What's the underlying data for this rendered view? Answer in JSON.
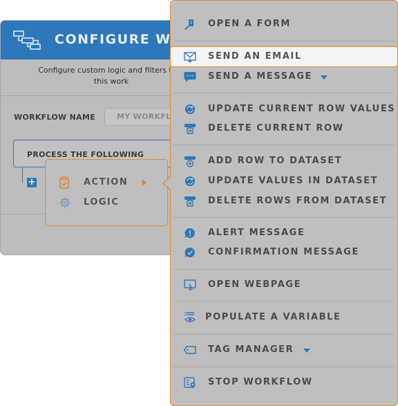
{
  "dialog": {
    "title": "CONFIGURE WO",
    "description_line1": "Configure custom logic and filters that",
    "description_line2": "this work",
    "workflow_name_label": "WORKFLOW NAME",
    "workflow_name_value": "MY WORKFLO",
    "process_label": "PROCESS THE FOLLOWING"
  },
  "popup": {
    "items": [
      {
        "label": "ACTION",
        "icon": "clipboard-check-icon"
      },
      {
        "label": "LOGIC",
        "icon": "lightbulb-gear-icon"
      }
    ]
  },
  "menu": {
    "items": [
      {
        "label": "OPEN A FORM",
        "icon": "form-pen-icon"
      },
      {
        "label": "SEND AN EMAIL",
        "icon": "envelope-icon",
        "highlighted": true
      },
      {
        "label": "SEND A MESSAGE",
        "icon": "chat-bubble-icon",
        "has_dropdown": true
      },
      {
        "label": "UPDATE CURRENT ROW VALUES",
        "icon": "refresh-row-icon"
      },
      {
        "label": "DELETE CURRENT ROW",
        "icon": "delete-row-icon"
      },
      {
        "label": "ADD ROW TO DATASET",
        "icon": "add-row-icon"
      },
      {
        "label": "UPDATE VALUES IN DATASET",
        "icon": "refresh-dataset-icon"
      },
      {
        "label": "DELETE ROWS FROM DATASET",
        "icon": "delete-rows-icon"
      },
      {
        "label": "ALERT MESSAGE",
        "icon": "alert-bubble-icon"
      },
      {
        "label": "CONFIRMATION MESSAGE",
        "icon": "check-bubble-icon"
      },
      {
        "label": "OPEN WEBPAGE",
        "icon": "monitor-cursor-icon"
      },
      {
        "label": "POPULATE A VARIABLE",
        "icon": "list-eye-icon"
      },
      {
        "label": "TAG MANAGER",
        "icon": "tag-icon",
        "has_dropdown": true
      },
      {
        "label": "STOP WORKFLOW",
        "icon": "stop-workflow-icon"
      }
    ]
  },
  "colors": {
    "accent_orange": "#e58a2e",
    "brand_blue": "#2d77bb",
    "overlay_gray": "#bfbfbf"
  }
}
